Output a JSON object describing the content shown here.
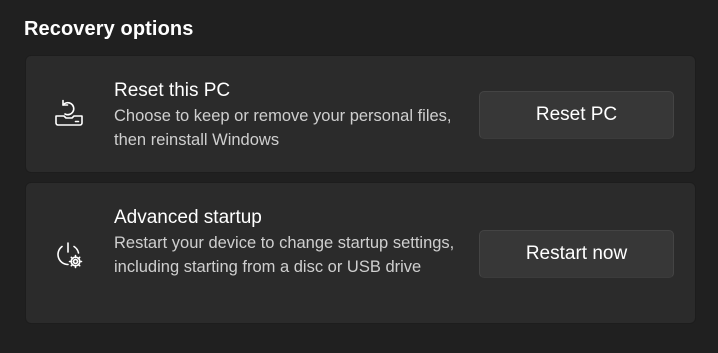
{
  "section": {
    "title": "Recovery options"
  },
  "reset": {
    "heading": "Reset this PC",
    "description": "Choose to keep or remove your personal files, then reinstall Windows",
    "button_label": "Reset PC",
    "icon": "reset-pc-icon"
  },
  "advanced": {
    "heading": "Advanced startup",
    "description": "Restart your device to change startup settings, including starting from a disc or USB drive",
    "button_label": "Restart now",
    "icon": "advanced-startup-icon"
  },
  "colors": {
    "background": "#202020",
    "card": "#2b2b2b",
    "button": "#373737",
    "text_primary": "#ffffff",
    "text_secondary": "#cfcfcf"
  }
}
